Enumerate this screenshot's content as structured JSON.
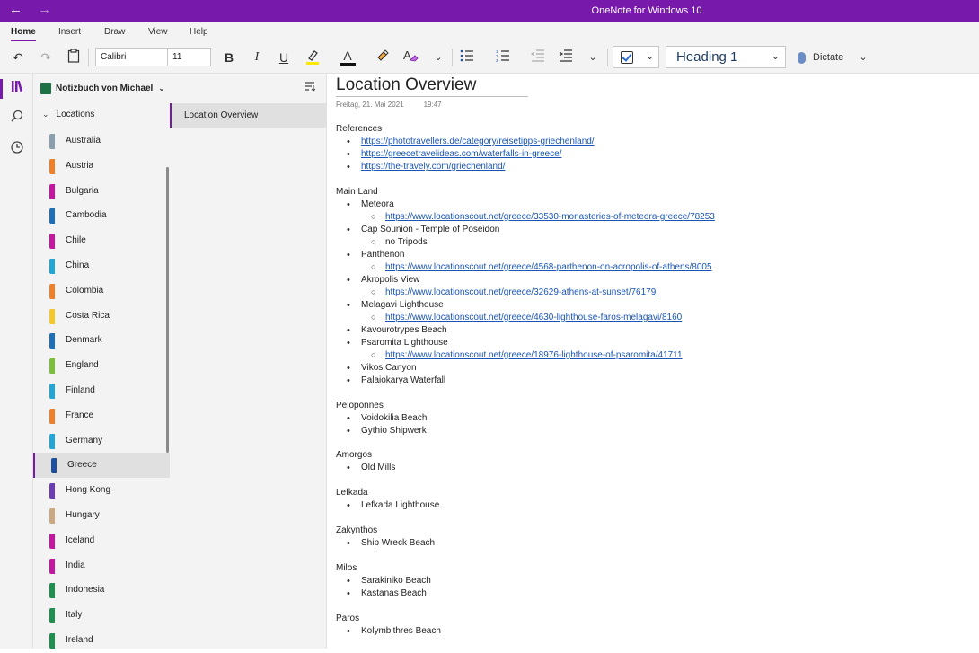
{
  "titlebar": {
    "title": "OneNote for Windows 10",
    "back": "←",
    "forward": "→"
  },
  "ribbon_tabs": [
    "Home",
    "Insert",
    "Draw",
    "View",
    "Help"
  ],
  "toolbar": {
    "font": "Calibri",
    "size": "11",
    "bold": "B",
    "italic": "I",
    "underline": "U",
    "font_color": "A",
    "style": "Heading 1",
    "dictate": "Dictate"
  },
  "notebook": {
    "name": "Notizbuch von Michael",
    "group": "Locations"
  },
  "sections": [
    {
      "name": "Australia",
      "color": "#8aa0ae"
    },
    {
      "name": "Austria",
      "color": "#f07f2a"
    },
    {
      "name": "Bulgaria",
      "color": "#c4169e"
    },
    {
      "name": "Cambodia",
      "color": "#1e6fb8"
    },
    {
      "name": "Chile",
      "color": "#c4169e"
    },
    {
      "name": "China",
      "color": "#21a6d6"
    },
    {
      "name": "Colombia",
      "color": "#f07f2a"
    },
    {
      "name": "Costa Rica",
      "color": "#f5c82a"
    },
    {
      "name": "Denmark",
      "color": "#1e6fb8"
    },
    {
      "name": "England",
      "color": "#7bbf3a"
    },
    {
      "name": "Finland",
      "color": "#21a6d6"
    },
    {
      "name": "France",
      "color": "#f07f2a"
    },
    {
      "name": "Germany",
      "color": "#21a6d6"
    },
    {
      "name": "Greece",
      "color": "#1e4fa0",
      "selected": true
    },
    {
      "name": "Hong Kong",
      "color": "#6a3db5"
    },
    {
      "name": "Hungary",
      "color": "#c9a882"
    },
    {
      "name": "Iceland",
      "color": "#c4169e"
    },
    {
      "name": "India",
      "color": "#c4169e"
    },
    {
      "name": "Indonesia",
      "color": "#1e8f4e"
    },
    {
      "name": "Italy",
      "color": "#1e8f4e"
    },
    {
      "name": "Ireland",
      "color": "#1e8f4e"
    }
  ],
  "pages": [
    "Location Overview"
  ],
  "page": {
    "title": "Location Overview",
    "date": "Freitag, 21. Mai 2021",
    "time": "19:47",
    "lines": [
      {
        "kind": "heading",
        "text": "References"
      },
      {
        "kind": "b1",
        "text": "https://phototravellers.de/category/reisetipps-griechenland/",
        "link": true
      },
      {
        "kind": "b1",
        "text": "https://greecetravelideas.com/waterfalls-in-greece/",
        "link": true
      },
      {
        "kind": "b1",
        "text": "https://the-travely.com/griechenland/",
        "link": true
      },
      {
        "kind": "spacer",
        "text": ""
      },
      {
        "kind": "heading",
        "text": "Main Land"
      },
      {
        "kind": "b1",
        "text": "Meteora"
      },
      {
        "kind": "b2",
        "text": "https://www.locationscout.net/greece/33530-monasteries-of-meteora-greece/78253",
        "link": true
      },
      {
        "kind": "b1",
        "text": "Cap Sounion - Temple of Poseidon"
      },
      {
        "kind": "b2",
        "text": "no Tripods"
      },
      {
        "kind": "b1",
        "text": "Panthenon"
      },
      {
        "kind": "b2",
        "text": "https://www.locationscout.net/greece/4568-parthenon-on-acropolis-of-athens/8005",
        "link": true
      },
      {
        "kind": "b1",
        "text": "Akropolis View"
      },
      {
        "kind": "b2",
        "text": "https://www.locationscout.net/greece/32629-athens-at-sunset/76179",
        "link": true
      },
      {
        "kind": "b1",
        "text": "Melagavi Lighthouse"
      },
      {
        "kind": "b2",
        "text": "https://www.locationscout.net/greece/4630-lighthouse-faros-melagavi/8160",
        "link": true
      },
      {
        "kind": "b1",
        "text": "Kavourotrypes Beach"
      },
      {
        "kind": "b1",
        "text": "Psaromita Lighthouse"
      },
      {
        "kind": "b2",
        "text": "https://www.locationscout.net/greece/18976-lighthouse-of-psaromita/41711",
        "link": true
      },
      {
        "kind": "b1",
        "text": "Vikos Canyon"
      },
      {
        "kind": "b1",
        "text": "Palaiokarya Waterfall"
      },
      {
        "kind": "spacer",
        "text": ""
      },
      {
        "kind": "heading",
        "text": "Peloponnes"
      },
      {
        "kind": "b1",
        "text": "Voidokilia Beach"
      },
      {
        "kind": "b1",
        "text": "Gythio Shipwerk"
      },
      {
        "kind": "spacer",
        "text": ""
      },
      {
        "kind": "heading",
        "text": "Amorgos"
      },
      {
        "kind": "b1",
        "text": "Old Mills"
      },
      {
        "kind": "spacer",
        "text": ""
      },
      {
        "kind": "heading",
        "text": "Lefkada"
      },
      {
        "kind": "b1",
        "text": "Lefkada Lighthouse"
      },
      {
        "kind": "spacer",
        "text": ""
      },
      {
        "kind": "heading",
        "text": "Zakynthos"
      },
      {
        "kind": "b1",
        "text": "Ship Wreck Beach"
      },
      {
        "kind": "spacer",
        "text": ""
      },
      {
        "kind": "heading",
        "text": "Milos"
      },
      {
        "kind": "b1",
        "text": "Sarakiniko Beach"
      },
      {
        "kind": "b1",
        "text": "Kastanas Beach"
      },
      {
        "kind": "spacer",
        "text": ""
      },
      {
        "kind": "heading",
        "text": "Paros"
      },
      {
        "kind": "b1",
        "text": "Kolymbithres Beach"
      }
    ]
  }
}
